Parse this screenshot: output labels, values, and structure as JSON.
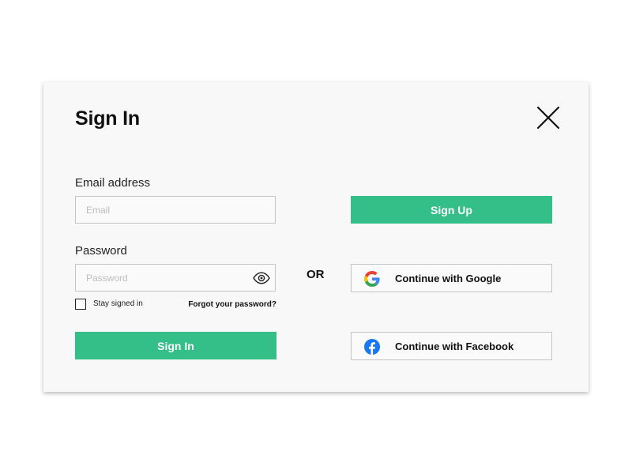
{
  "dialog": {
    "title": "Sign In",
    "close_icon": "close-icon"
  },
  "form": {
    "email_label": "Email address",
    "email_placeholder": "Email",
    "email_value": "",
    "password_label": "Password",
    "password_placeholder": "Password",
    "password_value": "",
    "password_toggle_icon": "eye-icon",
    "stay_signed_in_label": "Stay signed in",
    "stay_signed_in_checked": false,
    "forgot_password_label": "Forgot your password?",
    "sign_in_label": "Sign In"
  },
  "divider": {
    "or_label": "OR"
  },
  "alt": {
    "sign_up_label": "Sign Up",
    "google_label": "Continue with Google",
    "google_icon": "google-icon",
    "facebook_label": "Continue with Facebook",
    "facebook_icon": "facebook-icon"
  },
  "colors": {
    "accent_green": "#34bf88",
    "facebook_blue": "#1877f2",
    "modal_background": "#f8f8f8"
  }
}
